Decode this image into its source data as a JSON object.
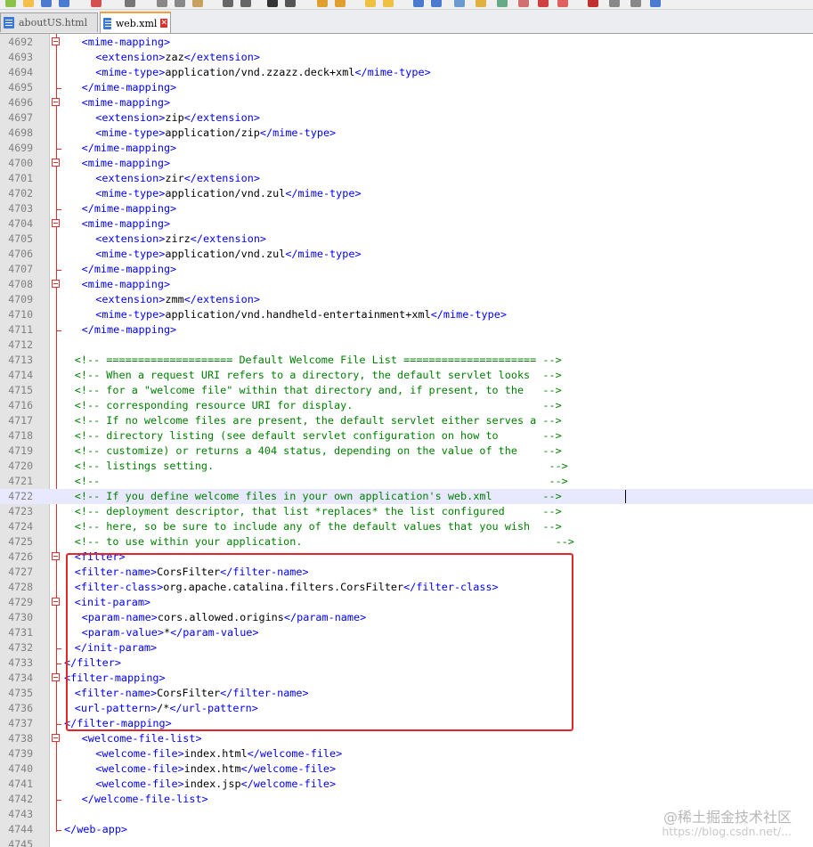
{
  "tabs": [
    {
      "label": "aboutUS.html",
      "active": false
    },
    {
      "label": "web.xml",
      "active": true
    }
  ],
  "lines": [
    {
      "n": "4692",
      "indent": 4,
      "parts": [
        [
          "t",
          "<mime-mapping>"
        ]
      ],
      "fold": "open"
    },
    {
      "n": "4693",
      "indent": 8,
      "parts": [
        [
          "t",
          "<extension>"
        ],
        [
          "x",
          "zaz"
        ],
        [
          "t",
          "</extension>"
        ]
      ]
    },
    {
      "n": "4694",
      "indent": 8,
      "parts": [
        [
          "t",
          "<mime-type>"
        ],
        [
          "x",
          "application/vnd.zzazz.deck+xml"
        ],
        [
          "t",
          "</mime-type>"
        ]
      ]
    },
    {
      "n": "4695",
      "indent": 4,
      "parts": [
        [
          "t",
          "</mime-mapping>"
        ]
      ],
      "fold": "end"
    },
    {
      "n": "4696",
      "indent": 4,
      "parts": [
        [
          "t",
          "<mime-mapping>"
        ]
      ],
      "fold": "open"
    },
    {
      "n": "4697",
      "indent": 8,
      "parts": [
        [
          "t",
          "<extension>"
        ],
        [
          "x",
          "zip"
        ],
        [
          "t",
          "</extension>"
        ]
      ]
    },
    {
      "n": "4698",
      "indent": 8,
      "parts": [
        [
          "t",
          "<mime-type>"
        ],
        [
          "x",
          "application/zip"
        ],
        [
          "t",
          "</mime-type>"
        ]
      ]
    },
    {
      "n": "4699",
      "indent": 4,
      "parts": [
        [
          "t",
          "</mime-mapping>"
        ]
      ],
      "fold": "end"
    },
    {
      "n": "4700",
      "indent": 4,
      "parts": [
        [
          "t",
          "<mime-mapping>"
        ]
      ],
      "fold": "open"
    },
    {
      "n": "4701",
      "indent": 8,
      "parts": [
        [
          "t",
          "<extension>"
        ],
        [
          "x",
          "zir"
        ],
        [
          "t",
          "</extension>"
        ]
      ]
    },
    {
      "n": "4702",
      "indent": 8,
      "parts": [
        [
          "t",
          "<mime-type>"
        ],
        [
          "x",
          "application/vnd.zul"
        ],
        [
          "t",
          "</mime-type>"
        ]
      ]
    },
    {
      "n": "4703",
      "indent": 4,
      "parts": [
        [
          "t",
          "</mime-mapping>"
        ]
      ],
      "fold": "end"
    },
    {
      "n": "4704",
      "indent": 4,
      "parts": [
        [
          "t",
          "<mime-mapping>"
        ]
      ],
      "fold": "open"
    },
    {
      "n": "4705",
      "indent": 8,
      "parts": [
        [
          "t",
          "<extension>"
        ],
        [
          "x",
          "zirz"
        ],
        [
          "t",
          "</extension>"
        ]
      ]
    },
    {
      "n": "4706",
      "indent": 8,
      "parts": [
        [
          "t",
          "<mime-type>"
        ],
        [
          "x",
          "application/vnd.zul"
        ],
        [
          "t",
          "</mime-type>"
        ]
      ]
    },
    {
      "n": "4707",
      "indent": 4,
      "parts": [
        [
          "t",
          "</mime-mapping>"
        ]
      ],
      "fold": "end"
    },
    {
      "n": "4708",
      "indent": 4,
      "parts": [
        [
          "t",
          "<mime-mapping>"
        ]
      ],
      "fold": "open"
    },
    {
      "n": "4709",
      "indent": 8,
      "parts": [
        [
          "t",
          "<extension>"
        ],
        [
          "x",
          "zmm"
        ],
        [
          "t",
          "</extension>"
        ]
      ]
    },
    {
      "n": "4710",
      "indent": 8,
      "parts": [
        [
          "t",
          "<mime-type>"
        ],
        [
          "x",
          "application/vnd.handheld-entertainment+xml"
        ],
        [
          "t",
          "</mime-type>"
        ]
      ]
    },
    {
      "n": "4711",
      "indent": 4,
      "parts": [
        [
          "t",
          "</mime-mapping>"
        ]
      ],
      "fold": "end"
    },
    {
      "n": "4712",
      "indent": 0,
      "parts": []
    },
    {
      "n": "4713",
      "indent": 2,
      "parts": [
        [
          "c",
          "<!-- ==================== Default Welcome File List ===================== -->"
        ]
      ]
    },
    {
      "n": "4714",
      "indent": 2,
      "parts": [
        [
          "c",
          "<!-- When a request URI refers to a directory, the default servlet looks  -->"
        ]
      ]
    },
    {
      "n": "4715",
      "indent": 2,
      "parts": [
        [
          "c",
          "<!-- for a \"welcome file\" within that directory and, if present, to the   -->"
        ]
      ]
    },
    {
      "n": "4716",
      "indent": 2,
      "parts": [
        [
          "c",
          "<!-- corresponding resource URI for display.                              -->"
        ]
      ]
    },
    {
      "n": "4717",
      "indent": 2,
      "parts": [
        [
          "c",
          "<!-- If no welcome files are present, the default servlet either serves a -->"
        ]
      ]
    },
    {
      "n": "4718",
      "indent": 2,
      "parts": [
        [
          "c",
          "<!-- directory listing (see default servlet configuration on how to       -->"
        ]
      ]
    },
    {
      "n": "4719",
      "indent": 2,
      "parts": [
        [
          "c",
          "<!-- customize) or returns a 404 status, depending on the value of the    -->"
        ]
      ]
    },
    {
      "n": "4720",
      "indent": 2,
      "parts": [
        [
          "c",
          "<!-- listings setting.                                                     -->"
        ]
      ]
    },
    {
      "n": "4721",
      "indent": 2,
      "parts": [
        [
          "c",
          "<!--                                                                       -->"
        ]
      ]
    },
    {
      "n": "4722",
      "indent": 2,
      "parts": [
        [
          "c",
          "<!-- If you define welcome files in your own application's web.xml        -->"
        ]
      ],
      "current": true
    },
    {
      "n": "4723",
      "indent": 2,
      "parts": [
        [
          "c",
          "<!-- deployment descriptor, that list *replaces* the list configured      -->"
        ]
      ]
    },
    {
      "n": "4724",
      "indent": 2,
      "parts": [
        [
          "c",
          "<!-- here, so be sure to include any of the default values that you wish  -->"
        ]
      ]
    },
    {
      "n": "4725",
      "indent": 2,
      "parts": [
        [
          "c",
          "<!-- to use within your application.                                        -->"
        ]
      ]
    },
    {
      "n": "4726",
      "indent": 2,
      "parts": [
        [
          "t",
          "<filter>"
        ]
      ],
      "fold": "open"
    },
    {
      "n": "4727",
      "indent": 2,
      "parts": [
        [
          "t",
          "<filter-name>"
        ],
        [
          "x",
          "CorsFilter"
        ],
        [
          "t",
          "</filter-name>"
        ]
      ]
    },
    {
      "n": "4728",
      "indent": 2,
      "parts": [
        [
          "t",
          "<filter-class>"
        ],
        [
          "x",
          "org.apache.catalina.filters.CorsFilter"
        ],
        [
          "t",
          "</filter-class>"
        ]
      ]
    },
    {
      "n": "4729",
      "indent": 2,
      "parts": [
        [
          "t",
          "<init-param>"
        ]
      ],
      "fold": "open"
    },
    {
      "n": "4730",
      "indent": 4,
      "parts": [
        [
          "t",
          "<param-name>"
        ],
        [
          "x",
          "cors.allowed.origins"
        ],
        [
          "t",
          "</param-name>"
        ]
      ]
    },
    {
      "n": "4731",
      "indent": 4,
      "parts": [
        [
          "t",
          "<param-value>"
        ],
        [
          "x",
          "*"
        ],
        [
          "t",
          "</param-value>"
        ]
      ]
    },
    {
      "n": "4732",
      "indent": 2,
      "parts": [
        [
          "t",
          "</init-param>"
        ]
      ],
      "fold": "end"
    },
    {
      "n": "4733",
      "indent": 0,
      "parts": [
        [
          "t",
          "</filter>"
        ]
      ],
      "fold": "end"
    },
    {
      "n": "4734",
      "indent": 0,
      "parts": [
        [
          "t",
          "<filter-mapping>"
        ]
      ],
      "fold": "open"
    },
    {
      "n": "4735",
      "indent": 2,
      "parts": [
        [
          "t",
          "<filter-name>"
        ],
        [
          "x",
          "CorsFilter"
        ],
        [
          "t",
          "</filter-name>"
        ]
      ]
    },
    {
      "n": "4736",
      "indent": 2,
      "parts": [
        [
          "t",
          "<url-pattern>"
        ],
        [
          "x",
          "/*"
        ],
        [
          "t",
          "</url-pattern>"
        ]
      ]
    },
    {
      "n": "4737",
      "indent": 0,
      "parts": [
        [
          "t",
          "</filter-mapping>"
        ]
      ],
      "fold": "end"
    },
    {
      "n": "4738",
      "indent": 4,
      "parts": [
        [
          "t",
          "<welcome-file-list>"
        ]
      ],
      "fold": "open"
    },
    {
      "n": "4739",
      "indent": 8,
      "parts": [
        [
          "t",
          "<welcome-file>"
        ],
        [
          "x",
          "index.html"
        ],
        [
          "t",
          "</welcome-file>"
        ]
      ]
    },
    {
      "n": "4740",
      "indent": 8,
      "parts": [
        [
          "t",
          "<welcome-file>"
        ],
        [
          "x",
          "index.htm"
        ],
        [
          "t",
          "</welcome-file>"
        ]
      ]
    },
    {
      "n": "4741",
      "indent": 8,
      "parts": [
        [
          "t",
          "<welcome-file>"
        ],
        [
          "x",
          "index.jsp"
        ],
        [
          "t",
          "</welcome-file>"
        ]
      ]
    },
    {
      "n": "4742",
      "indent": 4,
      "parts": [
        [
          "t",
          "</welcome-file-list>"
        ]
      ],
      "fold": "end"
    },
    {
      "n": "4743",
      "indent": 0,
      "parts": []
    },
    {
      "n": "4744",
      "indent": 0,
      "parts": [
        [
          "t",
          "</web-app>"
        ]
      ],
      "fold": "end"
    },
    {
      "n": "4745",
      "indent": 0,
      "parts": []
    }
  ],
  "watermark": {
    "line1": "@稀土掘金技术社区",
    "line2": "https://blog.csdn.net/..."
  },
  "colors": {
    "tag": "#0000ff",
    "text": "#000000",
    "comment": "#008000",
    "highlight_box": "#e4252a",
    "fold_marker": "#e03030"
  }
}
